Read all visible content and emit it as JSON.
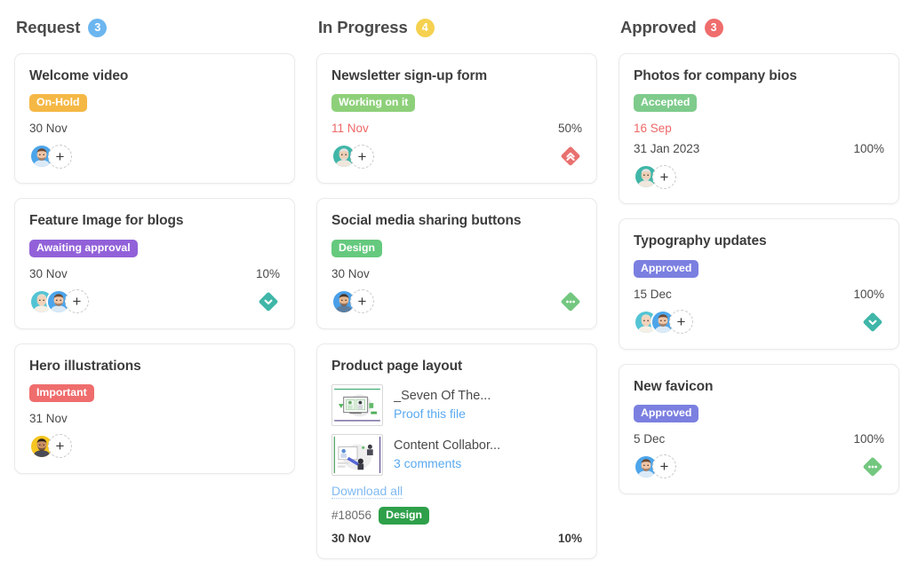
{
  "board": {
    "columns": [
      {
        "id": "request",
        "title": "Request",
        "count": "3",
        "count_color": "#6cb6f0",
        "cards": [
          {
            "title": "Welcome video",
            "tag": "On-Hold",
            "tag_color": "#f5b845",
            "date": "30 Nov",
            "date_overdue": false,
            "percent": "",
            "avatars": [
              "male-blue"
            ],
            "priority": null
          },
          {
            "title": "Feature Image for blogs",
            "tag": "Awaiting approval",
            "tag_color": "#9261d9",
            "date": "30 Nov",
            "date_overdue": false,
            "percent": "10%",
            "avatars": [
              "female-teal",
              "male-blue"
            ],
            "priority": "low"
          },
          {
            "title": "Hero illustrations",
            "tag": "Important",
            "tag_color": "#ef6d6d",
            "date": "31 Nov",
            "date_overdue": false,
            "percent": "",
            "avatars": [
              "male-yellow"
            ],
            "priority": null
          }
        ]
      },
      {
        "id": "in-progress",
        "title": "In Progress",
        "count": "4",
        "count_color": "#f5d14f",
        "cards": [
          {
            "title": "Newsletter sign-up form",
            "tag": "Working on it",
            "tag_color": "#8ed07a",
            "date": "11 Nov",
            "date_overdue": true,
            "percent": "50%",
            "avatars": [
              "elder-teal"
            ],
            "priority": "high"
          },
          {
            "title": "Social media sharing buttons",
            "tag": "Design",
            "tag_color": "#65c97e",
            "date": "30 Nov",
            "date_overdue": false,
            "percent": "",
            "avatars": [
              "male-glasses-blue"
            ],
            "priority": "medium"
          }
        ],
        "attachment_card": {
          "title": "Product page layout",
          "attachments": [
            {
              "name": "_Seven Of The...",
              "link": "Proof this file",
              "thumb": "presentation"
            },
            {
              "name": "Content Collabor...",
              "link": "3 comments",
              "thumb": "collaboration"
            }
          ],
          "download_all": "Download all",
          "id_number": "#18056",
          "id_tag": "Design",
          "id_tag_color": "#2ea04a",
          "date": "30 Nov",
          "percent": "10%"
        }
      },
      {
        "id": "approved",
        "title": "Approved",
        "count": "3",
        "count_color": "#ef6d6d",
        "cards": [
          {
            "title": "Photos for company bios",
            "tag": "Accepted",
            "tag_color": "#7ecb8c",
            "extra_date": "16 Sep",
            "date": "31 Jan 2023",
            "date_overdue": false,
            "percent": "100%",
            "avatars": [
              "elder-teal"
            ],
            "priority": null
          },
          {
            "title": "Typography updates",
            "tag": "Approved",
            "tag_color": "#7b7fe0",
            "date": "15 Dec",
            "date_overdue": false,
            "percent": "100%",
            "avatars": [
              "female-teal",
              "male-blue"
            ],
            "priority": "low"
          },
          {
            "title": "New favicon",
            "tag": "Approved",
            "tag_color": "#7b7fe0",
            "date": "5 Dec",
            "date_overdue": false,
            "percent": "100%",
            "avatars": [
              "male-blue"
            ],
            "priority": "medium"
          }
        ]
      }
    ]
  },
  "icons": {
    "add_member": "+",
    "priority_low": "chevron-down-icon",
    "priority_high": "double-chevron-up-icon",
    "priority_medium": "ellipsis-icon"
  },
  "colors": {
    "priority_low": "#3fb6a8",
    "priority_high": "#e8716f",
    "priority_medium": "#73c77f"
  }
}
